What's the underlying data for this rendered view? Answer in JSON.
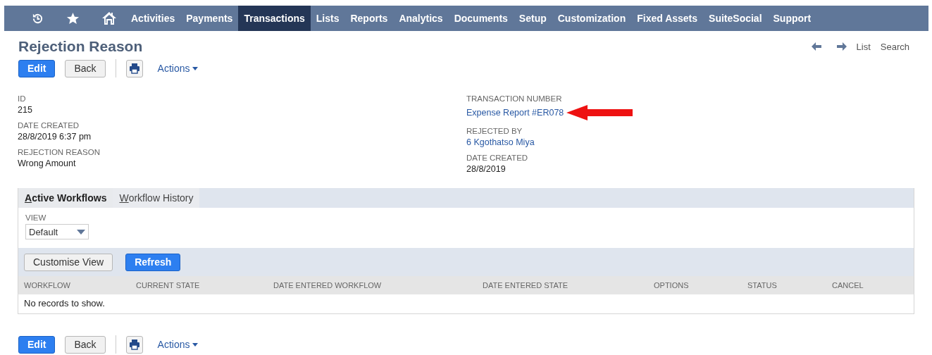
{
  "nav": {
    "icons": [
      {
        "kind": "recent"
      },
      {
        "kind": "star"
      },
      {
        "kind": "home"
      }
    ],
    "items": [
      {
        "label": "Activities",
        "selected": false
      },
      {
        "label": "Payments",
        "selected": false
      },
      {
        "label": "Transactions",
        "selected": true
      },
      {
        "label": "Lists",
        "selected": false
      },
      {
        "label": "Reports",
        "selected": false
      },
      {
        "label": "Analytics",
        "selected": false
      },
      {
        "label": "Documents",
        "selected": false
      },
      {
        "label": "Setup",
        "selected": false
      },
      {
        "label": "Customization",
        "selected": false
      },
      {
        "label": "Fixed Assets",
        "selected": false
      },
      {
        "label": "SuiteSocial",
        "selected": false
      },
      {
        "label": "Support",
        "selected": false
      }
    ]
  },
  "page": {
    "title": "Rejection Reason",
    "links": [
      "List",
      "Search"
    ]
  },
  "toolbar": {
    "edit": "Edit",
    "back": "Back",
    "actions": "Actions"
  },
  "fields_left": [
    {
      "label": "ID",
      "value": "215",
      "kind": "text"
    },
    {
      "label": "DATE CREATED",
      "value": "28/8/2019 6:37 pm",
      "kind": "text"
    },
    {
      "label": "REJECTION REASON",
      "value": "Wrong Amount",
      "kind": "text"
    }
  ],
  "fields_right": [
    {
      "label": "TRANSACTION NUMBER",
      "value": "Expense Report #ER078",
      "kind": "link",
      "pointer": true
    },
    {
      "label": "REJECTED BY",
      "value": "6 Kgothatso Miya",
      "kind": "link",
      "pointer": false
    },
    {
      "label": "DATE CREATED",
      "value": "28/8/2019",
      "kind": "text",
      "pointer": false
    }
  ],
  "subtabs": [
    {
      "label": "Active Workflows",
      "selected": true
    },
    {
      "label": "Workflow History",
      "selected": false
    }
  ],
  "view": {
    "label": "VIEW",
    "value": "Default"
  },
  "list_buttons": {
    "customise": "Customise View",
    "refresh": "Refresh"
  },
  "table": {
    "columns": [
      "WORKFLOW",
      "CURRENT STATE",
      "DATE ENTERED WORKFLOW",
      "DATE ENTERED STATE",
      "OPTIONS",
      "STATUS",
      "CANCEL"
    ],
    "empty": "No records to show."
  },
  "bottom_toolbar": {
    "edit": "Edit",
    "back": "Back",
    "actions": "Actions"
  }
}
